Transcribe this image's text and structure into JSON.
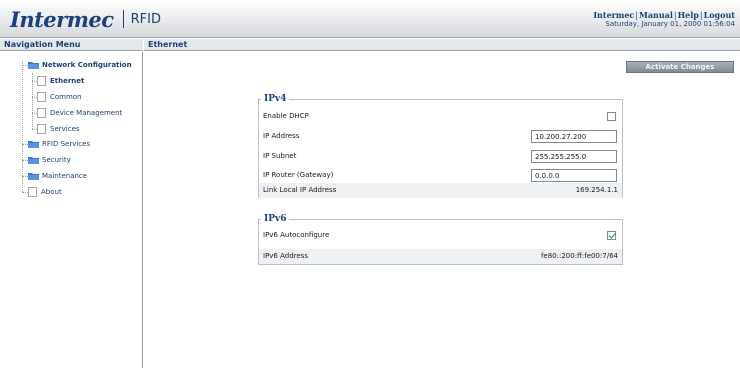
{
  "header": {
    "logo_text": "Intermec",
    "product": "RFID",
    "links": [
      "Intermec",
      "Manual",
      "Help",
      "Logout"
    ],
    "link_separator": "|",
    "datetime": "Saturday, January 01, 2000 01:56:04"
  },
  "nav": {
    "title": "Navigation Menu",
    "items": [
      {
        "label": "Network Configuration",
        "icon": "folder-icon",
        "bold": true
      },
      {
        "label": "Ethernet",
        "icon": "page-icon",
        "bold": true
      },
      {
        "label": "Common",
        "icon": "page-icon"
      },
      {
        "label": "Device Management",
        "icon": "page-icon"
      },
      {
        "label": "Services",
        "icon": "page-icon"
      },
      {
        "label": "RFID Services",
        "icon": "folder-icon"
      },
      {
        "label": "Security",
        "icon": "folder-icon"
      },
      {
        "label": "Maintenance",
        "icon": "folder-icon"
      },
      {
        "label": "About",
        "icon": "page-icon"
      }
    ]
  },
  "main": {
    "title": "Ethernet",
    "activate_label": "Activate Changes",
    "ipv4": {
      "legend": "IPv4",
      "enable_dhcp_label": "Enable DHCP",
      "enable_dhcp_checked": false,
      "ip_address_label": "IP Address",
      "ip_address_value": "10.200.27.200",
      "ip_subnet_label": "IP Subnet",
      "ip_subnet_value": "255.255.255.0",
      "ip_router_label": "IP Router (Gateway)",
      "ip_router_value": "0.0.0.0",
      "link_local_label": "Link Local IP Address",
      "link_local_value": "169.254.1.1"
    },
    "ipv6": {
      "legend": "IPv6",
      "autoconfigure_label": "IPv6 Autoconfigure",
      "autoconfigure_checked": true,
      "address_label": "IPv6 Address",
      "address_value": "fe80::200:ff:fe00:7/64"
    }
  },
  "colors": {
    "brand_blue": "#1d3f7a",
    "folder_blue": "#3a78c9",
    "check_green": "#2e8b2e"
  }
}
